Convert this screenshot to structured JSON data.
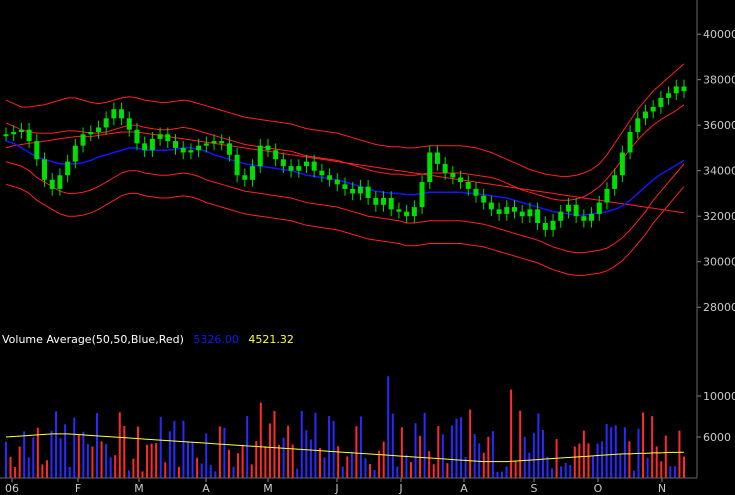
{
  "chart_data": [
    {
      "type": "candlestick",
      "ylim": [
        27000,
        41500
      ],
      "y_ticks": [
        "40000",
        "38000",
        "36000",
        "34000",
        "32000",
        "30000",
        "28000"
      ],
      "x_ticks": [
        "06",
        "F",
        "M",
        "A",
        "M",
        "J",
        "J",
        "A",
        "S",
        "O",
        "N"
      ],
      "grid": false,
      "colors": {
        "candle": "#00e000",
        "moving_average": "#1414ff",
        "bands": "#ff2020",
        "background": "#000000"
      },
      "price_close": [
        35600,
        35700,
        35800,
        35300,
        34500,
        33600,
        33200,
        33800,
        34400,
        35100,
        35600,
        35700,
        35900,
        36300,
        36700,
        36300,
        35800,
        35200,
        34900,
        35400,
        35600,
        35300,
        35000,
        34800,
        34900,
        35100,
        35200,
        35300,
        35200,
        34700,
        33800,
        33600,
        34200,
        35100,
        34900,
        34500,
        34200,
        34000,
        34200,
        34400,
        34000,
        33800,
        33600,
        33400,
        33200,
        33000,
        33300,
        32800,
        32500,
        32800,
        32300,
        32200,
        32000,
        32400,
        33500,
        34800,
        34300,
        33900,
        33700,
        33500,
        33200,
        32900,
        32600,
        32300,
        32100,
        32400,
        32200,
        32000,
        32300,
        31700,
        31400,
        31800,
        32200,
        32500,
        32000,
        31800,
        32100,
        32600,
        33200,
        33800,
        34800,
        35700,
        36300,
        36600,
        36800,
        37200,
        37400,
        37700,
        37500
      ],
      "moving_average": [
        35300,
        35200,
        35000,
        34800,
        34600,
        34500,
        34400,
        34300,
        34300,
        34300,
        34350,
        34450,
        34600,
        34700,
        34800,
        34900,
        35000,
        35000,
        34900,
        34900,
        34900,
        34900,
        34950,
        35000,
        35000,
        34950,
        34850,
        34700,
        34600,
        34500,
        34400,
        34300,
        34250,
        34200,
        34150,
        34100,
        34050,
        34000,
        33900,
        33800,
        33750,
        33700,
        33650,
        33600,
        33500,
        33400,
        33300,
        33200,
        33100,
        33050,
        33000,
        33000,
        32950,
        32950,
        33000,
        33050,
        33050,
        33050,
        33050,
        33050,
        33000,
        33000,
        32950,
        32900,
        32850,
        32800,
        32700,
        32600,
        32500,
        32400,
        32300,
        32200,
        32150,
        32100,
        32050,
        32050,
        32100,
        32150,
        32200,
        32300,
        32450,
        32700,
        33000,
        33300,
        33600,
        33850,
        34050,
        34250,
        34450
      ],
      "bands": [
        {
          "values": [
            37100,
            36950,
            36800,
            36800,
            36850,
            36900,
            37000,
            37100,
            37200,
            37200,
            37100,
            37000,
            36950,
            37000,
            37100,
            37200,
            37250,
            37200,
            37100,
            37050,
            37000,
            37000,
            37050,
            37100,
            37050,
            36950,
            36850,
            36750,
            36650,
            36550,
            36450,
            36350,
            36300,
            36250,
            36200,
            36150,
            36100,
            36050,
            35950,
            35850,
            35800,
            35750,
            35700,
            35650,
            35550,
            35450,
            35350,
            35250,
            35150,
            35100,
            35050,
            35050,
            35000,
            35000,
            35050,
            35100,
            35100,
            35100,
            35100,
            35100,
            35050,
            35000,
            34900,
            34800,
            34650,
            34500,
            34350,
            34200,
            34050,
            33950,
            33850,
            33800,
            33750,
            33750,
            33800,
            33900,
            34050,
            34300,
            34700,
            35200,
            35700,
            36200,
            36700,
            37100,
            37500,
            37800,
            38100,
            38400,
            38700
          ]
        },
        {
          "values": [
            36100,
            35950,
            35800,
            35700,
            35650,
            35650,
            35650,
            35700,
            35750,
            35750,
            35700,
            35650,
            35650,
            35700,
            35800,
            35900,
            36000,
            36000,
            35900,
            35850,
            35800,
            35800,
            35850,
            35900,
            35850,
            35750,
            35650,
            35550,
            35450,
            35350,
            35250,
            35150,
            35100,
            35050,
            35000,
            34950,
            34900,
            34850,
            34750,
            34650,
            34600,
            34550,
            34500,
            34450,
            34350,
            34250,
            34150,
            34050,
            33950,
            33900,
            33850,
            33850,
            33800,
            33800,
            33850,
            33900,
            33900,
            33900,
            33900,
            33900,
            33850,
            33800,
            33750,
            33700,
            33600,
            33450,
            33300,
            33150,
            33050,
            32950,
            32850,
            32750,
            32700,
            32700,
            32750,
            32850,
            33050,
            33300,
            33650,
            34050,
            34500,
            34950,
            35350,
            35700,
            36000,
            36250,
            36450,
            36650,
            36900
          ]
        },
        {
          "values": [
            34400,
            34300,
            34200,
            34000,
            33700,
            33500,
            33300,
            33100,
            33000,
            33000,
            33050,
            33150,
            33300,
            33500,
            33700,
            33900,
            34000,
            34000,
            33900,
            33850,
            33800,
            33800,
            33850,
            33900,
            33850,
            33750,
            33600,
            33500,
            33400,
            33300,
            33200,
            33100,
            33050,
            33000,
            32950,
            32900,
            32850,
            32800,
            32700,
            32600,
            32550,
            32500,
            32450,
            32400,
            32300,
            32200,
            32100,
            32000,
            31950,
            31900,
            31850,
            31800,
            31700,
            31700,
            31750,
            31800,
            31800,
            31800,
            31800,
            31800,
            31750,
            31700,
            31650,
            31550,
            31450,
            31350,
            31250,
            31150,
            31050,
            30950,
            30800,
            30650,
            30550,
            30450,
            30400,
            30400,
            30450,
            30500,
            30600,
            30800,
            31050,
            31400,
            31800,
            32200,
            32700,
            33100,
            33500,
            33900,
            34300
          ]
        },
        {
          "values": [
            33400,
            33300,
            33200,
            33000,
            32700,
            32500,
            32300,
            32100,
            32000,
            32000,
            32050,
            32150,
            32300,
            32500,
            32700,
            32900,
            33000,
            33000,
            32900,
            32850,
            32800,
            32800,
            32850,
            32900,
            32850,
            32750,
            32600,
            32500,
            32400,
            32300,
            32200,
            32100,
            32050,
            32000,
            31950,
            31900,
            31850,
            31800,
            31700,
            31600,
            31550,
            31500,
            31450,
            31400,
            31300,
            31200,
            31100,
            31000,
            30950,
            30900,
            30850,
            30800,
            30700,
            30700,
            30750,
            30800,
            30800,
            30800,
            30800,
            30800,
            30750,
            30700,
            30650,
            30550,
            30450,
            30350,
            30250,
            30150,
            30050,
            29950,
            29800,
            29650,
            29550,
            29450,
            29400,
            29400,
            29450,
            29500,
            29600,
            29800,
            30050,
            30400,
            30800,
            31200,
            31700,
            32100,
            32500,
            32900,
            33300
          ]
        },
        {
          "values": [
            35000,
            35100,
            35150,
            35200,
            35250,
            35300,
            35350,
            35400,
            35450,
            35500,
            35500,
            35500,
            35550,
            35600,
            35650,
            35700,
            35700,
            35700,
            35650,
            35600,
            35550,
            35500,
            35450,
            35400,
            35350,
            35300,
            35250,
            35200,
            35150,
            35100,
            35050,
            35000,
            34950,
            34900,
            34850,
            34800,
            34750,
            34700,
            34650,
            34600,
            34550,
            34500,
            34450,
            34400,
            34350,
            34300,
            34250,
            34200,
            34150,
            34100,
            34050,
            34000,
            33950,
            33900,
            33850,
            33800,
            33750,
            33700,
            33650,
            33600,
            33550,
            33500,
            33450,
            33400,
            33350,
            33300,
            33250,
            33200,
            33150,
            33100,
            33050,
            33000,
            32950,
            32900,
            32850,
            32800,
            32750,
            32700,
            32650,
            32600,
            32550,
            32500,
            32450,
            32400,
            32350,
            32300,
            32250,
            32200,
            32150
          ]
        }
      ]
    },
    {
      "type": "bar",
      "title": "Volume Average(50,50,Blue,Red)",
      "ma_values": [
        "5326.00",
        "4521.32"
      ],
      "ma_colors": [
        "#1414ff",
        "#ffff40"
      ],
      "ylim": [
        2000,
        14000
      ],
      "y_ticks": [
        "10000",
        "6000"
      ],
      "average_line": [
        6000,
        6050,
        6100,
        6150,
        6200,
        6250,
        6300,
        6300,
        6300,
        6250,
        6200,
        6150,
        6100,
        6050,
        6000,
        5950,
        5900,
        5850,
        5800,
        5750,
        5700,
        5650,
        5600,
        5550,
        5500,
        5450,
        5400,
        5350,
        5300,
        5250,
        5200,
        5150,
        5100,
        5050,
        5000,
        4950,
        4900,
        4850,
        4800,
        4750,
        4700,
        4650,
        4600,
        4550,
        4500,
        4450,
        4400,
        4350,
        4300,
        4250,
        4200,
        4150,
        4100,
        4050,
        4000,
        3950,
        3900,
        3850,
        3800,
        3750,
        3700,
        3650,
        3600,
        3600,
        3600,
        3600,
        3650,
        3700,
        3750,
        3800,
        3850,
        3900,
        3950,
        4000,
        4050,
        4100,
        4150,
        4200,
        4250,
        4300,
        4350,
        4350,
        4400,
        4400,
        4450,
        4450,
        4500,
        4500,
        4521
      ]
    }
  ]
}
